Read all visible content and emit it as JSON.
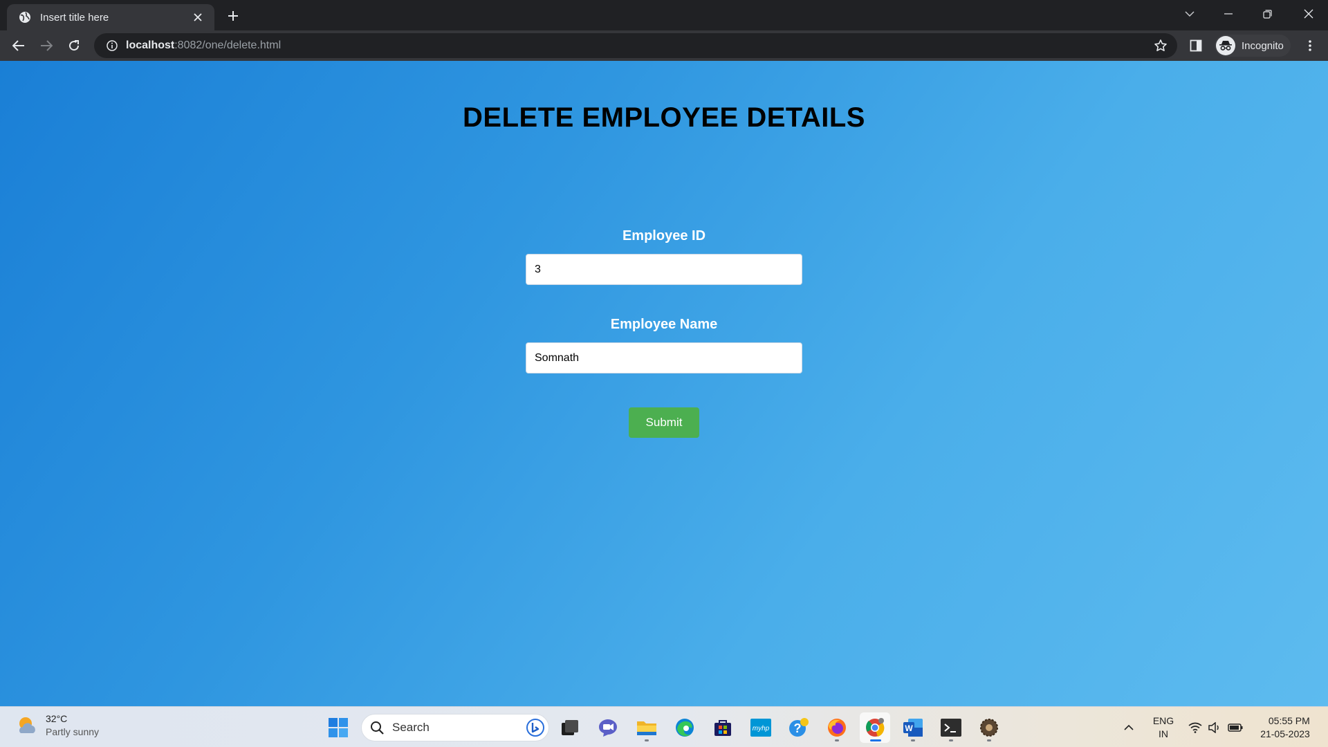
{
  "browser": {
    "tab_title": "Insert title here",
    "url_host": "localhost",
    "url_rest": ":8082/one/delete.html",
    "profile_label": "Incognito"
  },
  "page": {
    "title": "DELETE EMPLOYEE DETAILS",
    "employee_id": {
      "label": "Employee ID",
      "value": "3"
    },
    "employee_name": {
      "label": "Employee Name",
      "value": "Somnath"
    },
    "submit_label": "Submit"
  },
  "taskbar": {
    "weather_temp": "32°C",
    "weather_condition": "Partly sunny",
    "search_placeholder": "Search",
    "language_line1": "ENG",
    "language_line2": "IN",
    "time": "05:55 PM",
    "date": "21-05-2023",
    "apps": [
      "windows-start",
      "search",
      "task-view",
      "teams-chat",
      "file-explorer",
      "edge",
      "microsoft-store",
      "myhp",
      "help",
      "firefox",
      "chrome",
      "word",
      "terminal",
      "settings-app"
    ]
  },
  "colors": {
    "page_gradient_start": "#1a7fd6",
    "page_gradient_end": "#5dbbef",
    "submit_green": "#4caf50",
    "chrome_dark": "#202124"
  }
}
